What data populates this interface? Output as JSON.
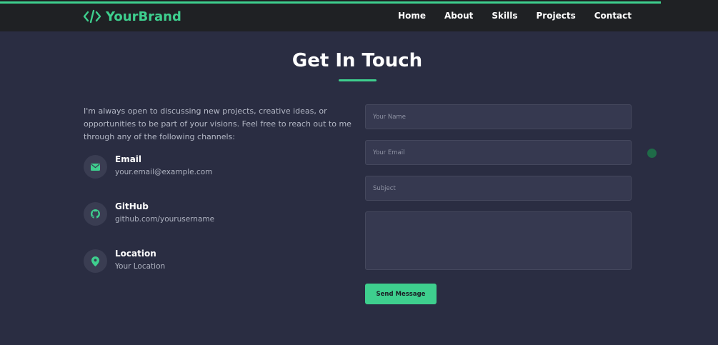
{
  "header": {
    "brand": "YourBrand",
    "brand_icon": "code-icon",
    "scroll_progress": 0.92,
    "nav": [
      {
        "label": "Home"
      },
      {
        "label": "About"
      },
      {
        "label": "Skills"
      },
      {
        "label": "Projects"
      },
      {
        "label": "Contact"
      }
    ]
  },
  "contact": {
    "title": "Get In Touch",
    "intro": "I'm always open to discussing new projects, creative ideas, or opportunities to be part of your visions. Feel free to reach out to me through any of the following channels:",
    "items": [
      {
        "label": "Email",
        "value": "your.email@example.com",
        "icon": "mail-icon"
      },
      {
        "label": "GitHub",
        "value": "github.com/yourusername",
        "icon": "github-icon"
      },
      {
        "label": "Location",
        "value": "Your Location",
        "icon": "map-pin-icon"
      }
    ],
    "form": {
      "name_placeholder": "Your Name",
      "email_placeholder": "Your Email",
      "subject_placeholder": "Subject",
      "message_placeholder": "",
      "submit_label": "Send Message"
    }
  },
  "colors": {
    "accent": "#3ecf8e",
    "background": "#2a2d42",
    "navbar": "#1f2124",
    "field": "#363950"
  }
}
